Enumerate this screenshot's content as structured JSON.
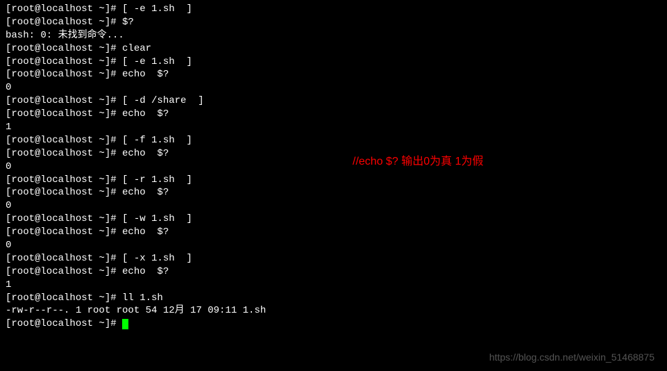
{
  "prompt": "[root@localhost ~]# ",
  "lines": {
    "l0": "[root@localhost ~]# [ -e 1.sh  ]",
    "l1": "[root@localhost ~]# $?",
    "l2": "bash: 0: 未找到命令...",
    "l3": "[root@localhost ~]# clear",
    "l4": "[root@localhost ~]# [ -e 1.sh  ]",
    "l5": "[root@localhost ~]# echo  $?",
    "l6": "0",
    "l7": "[root@localhost ~]# [ -d /share  ]",
    "l8": "[root@localhost ~]# echo  $?",
    "l9": "1",
    "l10": "[root@localhost ~]# [ -f 1.sh  ]",
    "l11": "[root@localhost ~]# echo  $?",
    "l12": "0",
    "l13": "[root@localhost ~]# [ -r 1.sh  ]",
    "l14": "[root@localhost ~]# echo  $?",
    "l15": "0",
    "l16": "[root@localhost ~]# [ -w 1.sh  ]",
    "l17": "[root@localhost ~]# echo  $?",
    "l18": "0",
    "l19": "[root@localhost ~]# [ -x 1.sh  ]",
    "l20": "[root@localhost ~]# echo  $?",
    "l21": "1",
    "l22": "[root@localhost ~]# ll 1.sh",
    "l23": "-rw-r--r--. 1 root root 54 12月 17 09:11 1.sh",
    "l24": "[root@localhost ~]# "
  },
  "annotation": "//echo $? 输出0为真  1为假",
  "watermark": "https://blog.csdn.net/weixin_51468875"
}
